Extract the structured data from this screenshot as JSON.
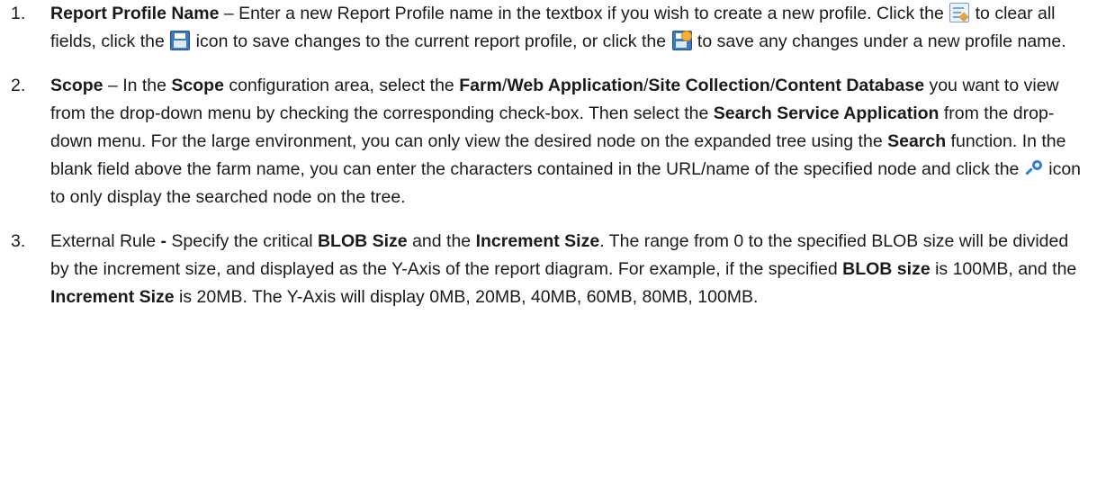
{
  "items": [
    {
      "number": "1.",
      "segments": [
        {
          "bold": true,
          "text": "Report Profile Name"
        },
        {
          "bold": false,
          "text": " – Enter a new Report Profile name in the textbox if you wish to create a new profile. Click the "
        },
        {
          "icon": "clear-fields-icon"
        },
        {
          "bold": false,
          "text": " to clear all fields, click the "
        },
        {
          "icon": "save-icon"
        },
        {
          "bold": false,
          "text": " icon to save changes to the current report profile, or click the "
        },
        {
          "icon": "save-as-icon"
        },
        {
          "bold": false,
          "text": " to save any changes under a new profile name."
        }
      ]
    },
    {
      "number": "2.",
      "segments": [
        {
          "bold": true,
          "text": "Scope"
        },
        {
          "bold": false,
          "text": " – In the "
        },
        {
          "bold": true,
          "text": "Scope"
        },
        {
          "bold": false,
          "text": " configuration area, select the "
        },
        {
          "bold": true,
          "text": "Farm"
        },
        {
          "bold": false,
          "text": "/"
        },
        {
          "bold": true,
          "text": "Web Application"
        },
        {
          "bold": false,
          "text": "/"
        },
        {
          "bold": true,
          "text": "Site Collection"
        },
        {
          "bold": false,
          "text": "/"
        },
        {
          "bold": true,
          "text": "Content Database"
        },
        {
          "bold": false,
          "text": "  you want to view from the drop-down menu by checking the corresponding check-box. Then select the "
        },
        {
          "bold": true,
          "text": "Search Service Application"
        },
        {
          "bold": false,
          "text": " from the drop-down menu. For the large environment, you can only view the desired node on the expanded tree using the "
        },
        {
          "bold": true,
          "text": "Search"
        },
        {
          "bold": false,
          "text": " function. In the blank field above the farm name, you can enter the characters contained in the URL/name of the specified node and click the "
        },
        {
          "icon": "search-icon"
        },
        {
          "bold": false,
          "text": " icon to only display the searched node on the tree."
        }
      ]
    },
    {
      "number": "3.",
      "segments": [
        {
          "bold": false,
          "text": "External Rule "
        },
        {
          "bold": true,
          "text": "-"
        },
        {
          "bold": false,
          "text": " Specify the critical "
        },
        {
          "bold": true,
          "text": "BLOB Size"
        },
        {
          "bold": false,
          "text": " and the "
        },
        {
          "bold": true,
          "text": "Increment Size"
        },
        {
          "bold": false,
          "text": ". The range from 0 to the specified BLOB size will be divided by the increment size, and displayed as the Y-Axis of the report diagram. For example, if the specified "
        },
        {
          "bold": true,
          "text": "BLOB size"
        },
        {
          "bold": false,
          "text": " is 100MB, and the "
        },
        {
          "bold": true,
          "text": "Increment Size"
        },
        {
          "bold": false,
          "text": " is 20MB. The Y-Axis will display 0MB, 20MB, 40MB, 60MB, 80MB, 100MB."
        }
      ]
    }
  ]
}
